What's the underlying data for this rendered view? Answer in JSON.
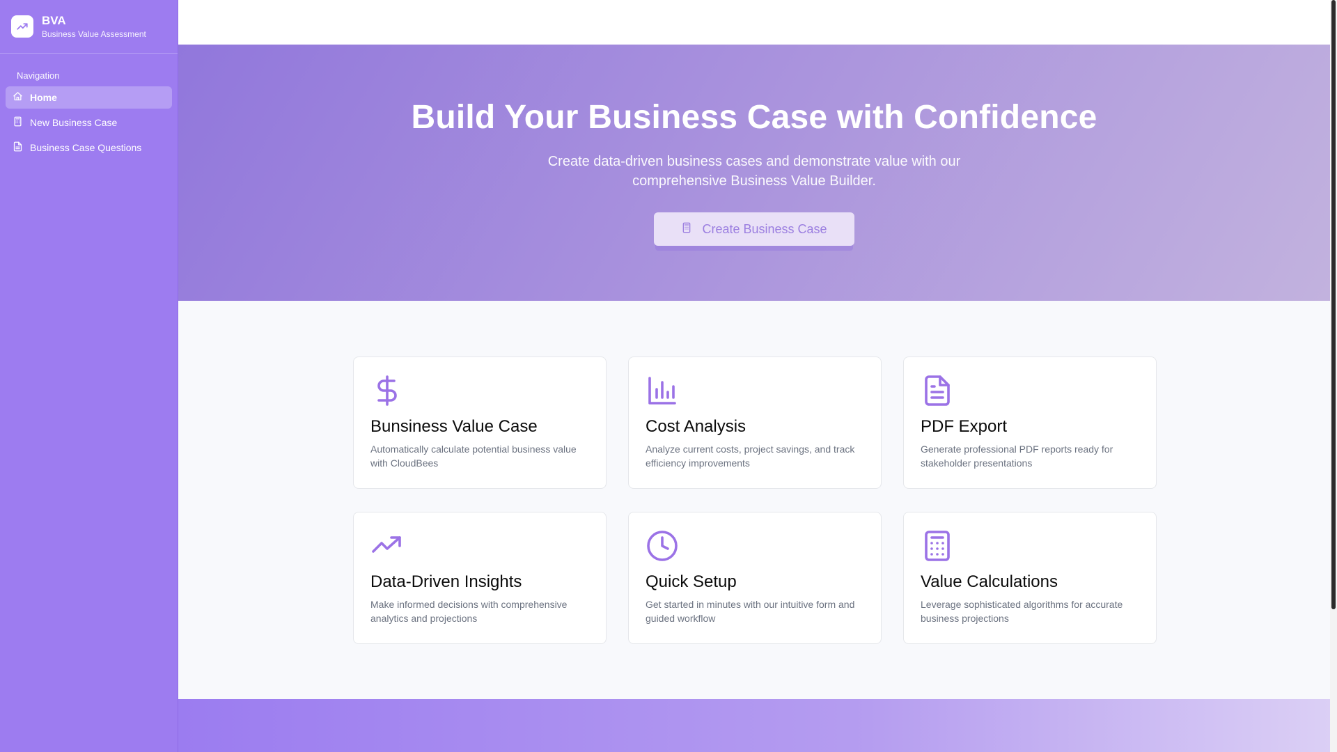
{
  "brand": {
    "title": "BVA",
    "subtitle": "Business Value Assessment",
    "icon": "trending-up-icon"
  },
  "nav": {
    "heading": "Navigation",
    "items": [
      {
        "label": "Home",
        "icon": "home-icon",
        "active": true
      },
      {
        "label": "New Business Case",
        "icon": "calculator-icon",
        "active": false
      },
      {
        "label": "Business Case Questions",
        "icon": "document-icon",
        "active": false
      }
    ]
  },
  "hero": {
    "title": "Build Your Business Case with Confidence",
    "subtitle": "Create data-driven business cases and demonstrate value with our comprehensive Business Value Builder.",
    "cta_label": "Create Business Case"
  },
  "features": [
    {
      "icon": "dollar-icon",
      "title": "Bunsiness Value Case",
      "description": "Automatically calculate potential business value with CloudBees"
    },
    {
      "icon": "bar-chart-icon",
      "title": "Cost Analysis",
      "description": "Analyze current costs, project savings, and track efficiency improvements"
    },
    {
      "icon": "file-text-icon",
      "title": "PDF Export",
      "description": "Generate professional PDF reports ready for stakeholder presentations"
    },
    {
      "icon": "trending-up-icon",
      "title": "Data-Driven Insights",
      "description": "Make informed decisions with comprehensive analytics and projections"
    },
    {
      "icon": "clock-icon",
      "title": "Quick Setup",
      "description": "Get started in minutes with our intuitive form and guided workflow"
    },
    {
      "icon": "calculator-icon",
      "title": "Value Calculations",
      "description": "Leverage sophisticated algorithms for accurate business projections"
    }
  ],
  "colors": {
    "sidebar": "#9d7cf0",
    "accent": "#9b7ee0",
    "hero_start": "#9177dc",
    "hero_end": "#c2b2de"
  }
}
